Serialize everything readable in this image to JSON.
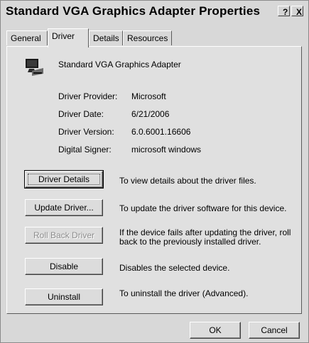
{
  "window": {
    "title": "Standard VGA Graphics Adapter Properties",
    "help_glyph": "?",
    "close_glyph": "X"
  },
  "tabs": [
    {
      "label": "General",
      "active": false
    },
    {
      "label": "Driver",
      "active": true
    },
    {
      "label": "Details",
      "active": false
    },
    {
      "label": "Resources",
      "active": false
    }
  ],
  "device": {
    "icon": "display-adapter-icon",
    "name": "Standard VGA Graphics Adapter"
  },
  "properties": [
    {
      "label": "Driver Provider:",
      "value": "Microsoft"
    },
    {
      "label": "Driver Date:",
      "value": "6/21/2006"
    },
    {
      "label": "Driver Version:",
      "value": "6.0.6001.16606"
    },
    {
      "label": "Digital Signer:",
      "value": "microsoft windows"
    }
  ],
  "actions": [
    {
      "label": "Driver Details",
      "description": "To view details about the driver files.",
      "enabled": true
    },
    {
      "label": "Update Driver...",
      "description": "To update the driver software for this device.",
      "enabled": true
    },
    {
      "label": "Roll Back Driver",
      "description": "If the device fails after updating the driver, roll back to the previously installed driver.",
      "enabled": false
    },
    {
      "label": "Disable",
      "description": "Disables the selected device.",
      "enabled": true
    },
    {
      "label": "Uninstall",
      "description": "To uninstall the driver (Advanced).",
      "enabled": true
    }
  ],
  "footer": {
    "ok_label": "OK",
    "cancel_label": "Cancel"
  }
}
